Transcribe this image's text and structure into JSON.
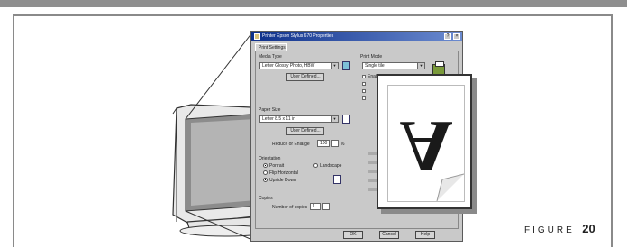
{
  "dialog": {
    "title": "Printer Epson Stylus 670 Properties",
    "tabs": [
      "Print Settings"
    ],
    "media_type": {
      "label": "Media Type",
      "value": "Letter Glossy Photo, HBW",
      "button": "User Defined..."
    },
    "paper_size": {
      "label": "Paper Size",
      "value": "Letter 8.5 x 11 in",
      "button": "User Defined..."
    },
    "reduce_enlarge": {
      "label": "Reduce or Enlarge",
      "value": "100",
      "unit": "%"
    },
    "orientation": {
      "label": "Orientation",
      "options": [
        "Portrait",
        "Landscape",
        "Flip Horizontal",
        "Upside Down"
      ]
    },
    "copies": {
      "label": "Copies",
      "number_label": "Number of copies",
      "value": "1"
    },
    "print_mode": {
      "label": "Print Mode",
      "value": "Single tile",
      "options": [
        "Enabled all",
        "",
        "",
        ""
      ]
    },
    "buttons": {
      "ok": "OK",
      "cancel": "Cancel",
      "help": "Help"
    }
  },
  "magnified_glyph": "A",
  "figure": {
    "word": "FIGURE",
    "number": "20"
  },
  "colors": {
    "frame": "#8a8a8a",
    "title_bar": "#0d2f8a",
    "dialog_face": "#c9c9c9",
    "shadow": "#8a8a8a"
  },
  "icons": [
    "monitor-illustration",
    "printer-icon",
    "magnify-callout",
    "page-curl-icon"
  ]
}
